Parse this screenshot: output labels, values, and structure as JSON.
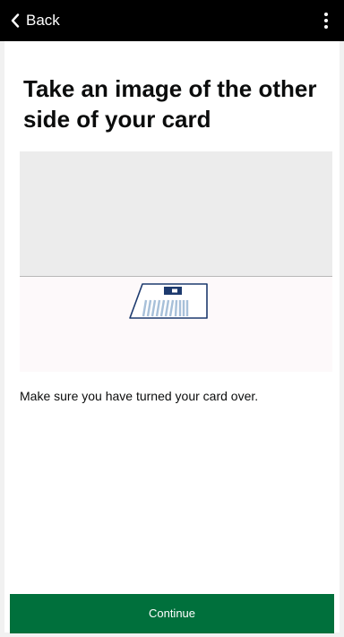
{
  "header": {
    "back_label": "Back",
    "menu_icon": "more-vertical-icon",
    "back_icon": "chevron-left-icon"
  },
  "main": {
    "title": "Take an image of the other side of your card",
    "illustration_icon": "id-card-back-icon",
    "instruction": "Make sure you have turned your card over."
  },
  "footer": {
    "continue_label": "Continue"
  },
  "colors": {
    "header_bg": "#000000",
    "primary_button": "#00703c",
    "card_outline": "#1d3a6e",
    "card_stripes": "#a7c0d9"
  }
}
